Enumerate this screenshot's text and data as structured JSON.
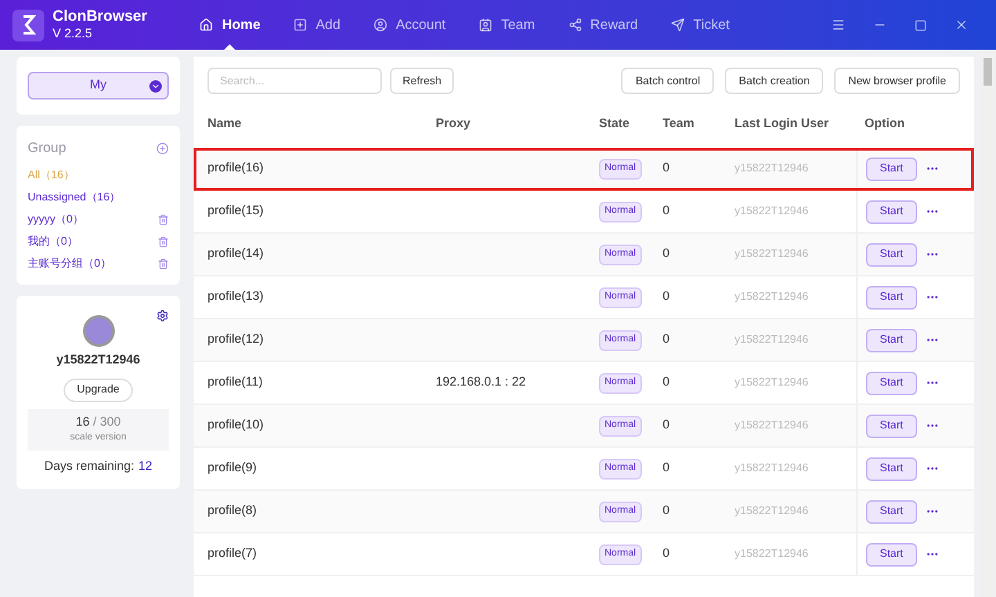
{
  "app": {
    "name": "ClonBrowser",
    "version": "V 2.2.5"
  },
  "nav": [
    {
      "label": "Home",
      "selected": true
    },
    {
      "label": "Add",
      "selected": false
    },
    {
      "label": "Account",
      "selected": false
    },
    {
      "label": "Team",
      "selected": false
    },
    {
      "label": "Reward",
      "selected": false
    },
    {
      "label": "Ticket",
      "selected": false
    }
  ],
  "scope_select": {
    "value": "My"
  },
  "groups": {
    "title": "Group",
    "items": [
      {
        "label": "All（16）",
        "selected": true,
        "deletable": false
      },
      {
        "label": "Unassigned（16）",
        "selected": false,
        "deletable": false
      },
      {
        "label": "yyyyy（0）",
        "selected": false,
        "deletable": true
      },
      {
        "label": "我的（0）",
        "selected": false,
        "deletable": true
      },
      {
        "label": "主账号分组（0）",
        "selected": false,
        "deletable": true
      }
    ]
  },
  "account": {
    "username": "y15822T12946",
    "upgrade": "Upgrade",
    "usage": "16",
    "limit": "/ 300",
    "plan": "scale version",
    "days_label": "Days remaining:",
    "days": "12"
  },
  "toolbar": {
    "search_placeholder": "Search...",
    "refresh": "Refresh",
    "buttons": [
      "Batch control",
      "Batch creation",
      "New browser profile"
    ]
  },
  "table": {
    "columns": [
      "Name",
      "Proxy",
      "State",
      "Team",
      "Last Login User",
      "Option"
    ],
    "rows": [
      {
        "name": "profile(16)",
        "state": "Normal",
        "team": "0",
        "user": "y15822T12946",
        "action": "Start",
        "selected": true
      },
      {
        "name": "profile(15)",
        "state": "Normal",
        "team": "0",
        "user": "y15822T12946",
        "action": "Start",
        "selected": false
      },
      {
        "name": "profile(14)",
        "state": "Normal",
        "team": "0",
        "user": "y15822T12946",
        "action": "Start",
        "selected": false
      },
      {
        "name": "profile(13)",
        "state": "Normal",
        "team": "0",
        "user": "y15822T12946",
        "action": "Start",
        "selected": false
      },
      {
        "name": "profile(12)",
        "state": "Normal",
        "team": "0",
        "user": "y15822T12946",
        "action": "Start",
        "selected": false
      },
      {
        "name": "profile(11)",
        "proxy": "192.168.0.1 : 22",
        "state": "Normal",
        "team": "0",
        "user": "y15822T12946",
        "action": "Start",
        "selected": false
      },
      {
        "name": "profile(10)",
        "state": "Normal",
        "team": "0",
        "user": "y15822T12946",
        "action": "Start",
        "selected": false
      },
      {
        "name": "profile(9)",
        "state": "Normal",
        "team": "0",
        "user": "y15822T12946",
        "action": "Start",
        "selected": false
      },
      {
        "name": "profile(8)",
        "state": "Normal",
        "team": "0",
        "user": "y15822T12946",
        "action": "Start",
        "selected": false
      },
      {
        "name": "profile(7)",
        "state": "Normal",
        "team": "0",
        "user": "y15822T12946",
        "action": "Start",
        "selected": false
      }
    ]
  }
}
